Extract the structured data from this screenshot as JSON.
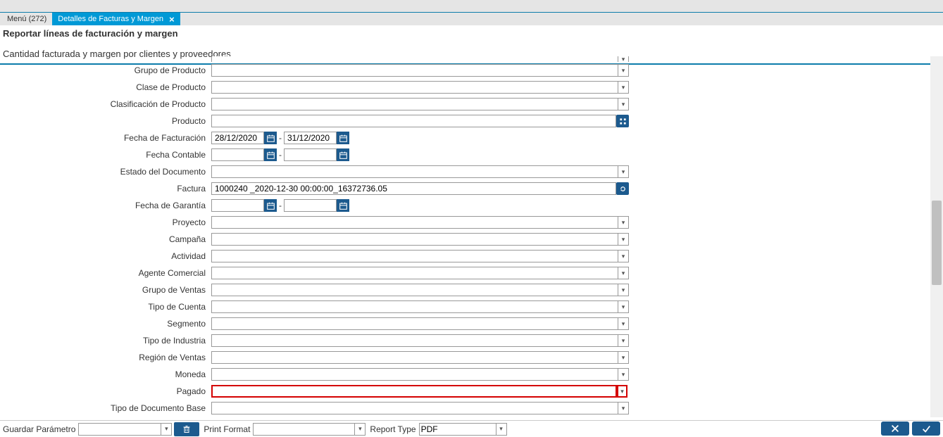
{
  "tabs": {
    "menu": "Menú (272)",
    "active": "Detalles de Facturas y Margen"
  },
  "header": {
    "title": "Reportar líneas de facturación y margen",
    "subtitle": "Cantidad facturada y margen por clientes y proveedores"
  },
  "fields": {
    "grupo_producto": {
      "label": "Grupo de Producto",
      "value": ""
    },
    "clase_producto": {
      "label": "Clase de Producto",
      "value": ""
    },
    "clasificacion": {
      "label": "Clasificación de Producto",
      "value": ""
    },
    "producto": {
      "label": "Producto",
      "value": ""
    },
    "fecha_factura": {
      "label": "Fecha de Facturación",
      "from": "28/12/2020",
      "to": "31/12/2020"
    },
    "fecha_contable": {
      "label": "Fecha Contable",
      "from": "",
      "to": ""
    },
    "estado_doc": {
      "label": "Estado del Documento",
      "value": ""
    },
    "factura": {
      "label": "Factura",
      "value": "1000240 _2020-12-30 00:00:00_16372736.05"
    },
    "fecha_garantia": {
      "label": "Fecha de Garantía",
      "from": "",
      "to": ""
    },
    "proyecto": {
      "label": "Proyecto",
      "value": ""
    },
    "campana": {
      "label": "Campaña",
      "value": ""
    },
    "actividad": {
      "label": "Actividad",
      "value": ""
    },
    "agente": {
      "label": "Agente Comercial",
      "value": ""
    },
    "grupo_ventas": {
      "label": "Grupo de Ventas",
      "value": ""
    },
    "tipo_cuenta": {
      "label": "Tipo de Cuenta",
      "value": ""
    },
    "segmento": {
      "label": "Segmento",
      "value": ""
    },
    "tipo_industria": {
      "label": "Tipo de Industria",
      "value": ""
    },
    "region_ventas": {
      "label": "Región de Ventas",
      "value": ""
    },
    "moneda": {
      "label": "Moneda",
      "value": ""
    },
    "pagado": {
      "label": "Pagado",
      "value": ""
    },
    "tipo_doc_base": {
      "label": "Tipo de Documento Base",
      "value": ""
    }
  },
  "footer": {
    "guardar_param": "Guardar Parámetro",
    "guardar_val": "",
    "print_format": "Print Format",
    "print_format_val": "",
    "report_type": "Report Type",
    "report_type_val": "PDF"
  }
}
